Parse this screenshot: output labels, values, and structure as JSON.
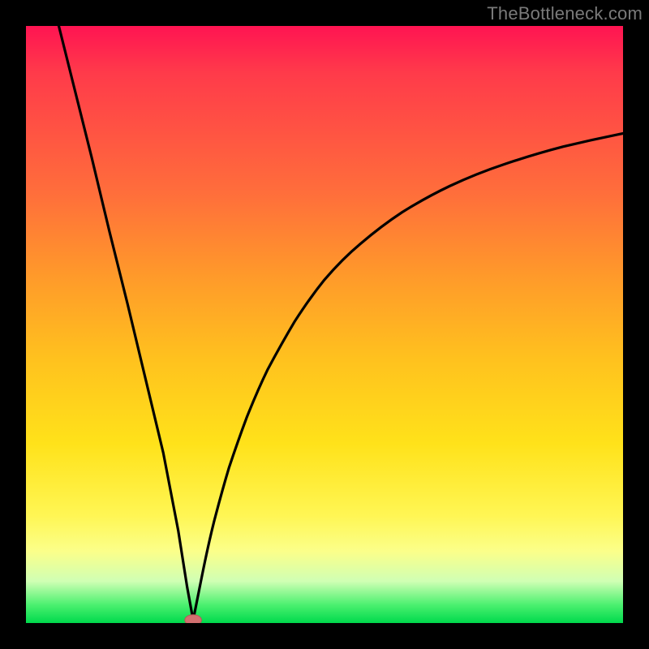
{
  "watermark": "TheBottleneck.com",
  "colors": {
    "frame_border": "#000000",
    "curve_stroke": "#000000",
    "marker_fill": "#d27070",
    "gradient_top": "#ff1452",
    "gradient_bottom": "#00d94c"
  },
  "chart_data": {
    "type": "line",
    "title": "",
    "xlabel": "",
    "ylabel": "",
    "xlim": [
      0,
      10
    ],
    "ylim": [
      0,
      10
    ],
    "legend": null,
    "grid": false,
    "annotations": [
      "TheBottleneck.com"
    ],
    "series": [
      {
        "name": "left-branch",
        "comment": "steep near-linear descent from top-left into the minimum",
        "x": [
          0.55,
          0.8,
          1.1,
          1.4,
          1.7,
          2.0,
          2.3,
          2.55,
          2.7,
          2.8
        ],
        "y": [
          10.0,
          9.0,
          7.8,
          6.55,
          5.35,
          4.1,
          2.85,
          1.55,
          0.6,
          0.05
        ]
      },
      {
        "name": "right-branch",
        "comment": "rises from the same minimum, decelerating toward an asymptote near y≈8.2",
        "x": [
          2.8,
          2.95,
          3.15,
          3.4,
          3.7,
          4.05,
          4.5,
          5.0,
          5.6,
          6.3,
          7.1,
          8.0,
          9.0,
          10.0
        ],
        "y": [
          0.05,
          0.8,
          1.7,
          2.6,
          3.45,
          4.25,
          5.05,
          5.75,
          6.35,
          6.88,
          7.32,
          7.68,
          7.98,
          8.2
        ]
      }
    ],
    "marker": {
      "x": 2.8,
      "y": 0.05,
      "shape": "ellipse",
      "color": "#d27070"
    }
  }
}
